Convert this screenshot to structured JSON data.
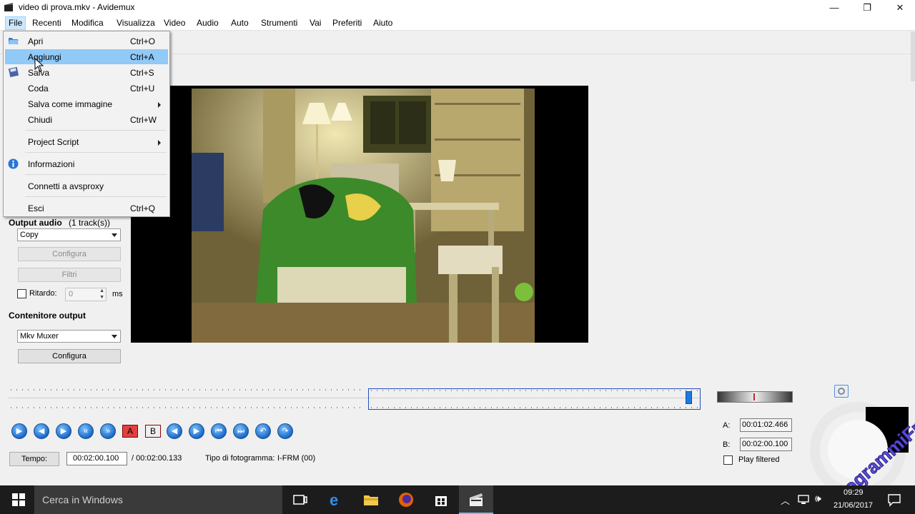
{
  "window": {
    "title": "video di prova.mkv - Avidemux",
    "minimize_glyph": "—",
    "maximize_glyph": "❐",
    "close_glyph": "✕"
  },
  "menubar": [
    "File",
    "Recenti",
    "Modifica",
    "Visualizza",
    "Video",
    "Audio",
    "Auto",
    "Strumenti",
    "Vai",
    "Preferiti",
    "Aiuto"
  ],
  "file_menu": {
    "items": [
      {
        "label": "Apri",
        "shortcut": "Ctrl+O",
        "icon": "open-folder-icon"
      },
      {
        "label": "Aggiungi",
        "shortcut": "Ctrl+A",
        "highlighted": true
      },
      {
        "label": "Salva",
        "shortcut": "Ctrl+S",
        "icon": "save-icon"
      },
      {
        "label": "Coda",
        "shortcut": "Ctrl+U"
      },
      {
        "label": "Salva come immagine",
        "submenu": true
      },
      {
        "label": "Chiudi",
        "shortcut": "Ctrl+W"
      },
      {
        "label": "Project Script",
        "submenu": true
      },
      {
        "label": "Informazioni",
        "icon": "info-icon"
      },
      {
        "label": "Connetti a avsproxy"
      },
      {
        "label": "Esci",
        "shortcut": "Ctrl+Q"
      }
    ]
  },
  "left_panel": {
    "output_audio_label": "Output audio",
    "output_audio_tracks": "(1 track(s))",
    "audio_codec": "Copy",
    "configure_label": "Configura",
    "filters_label": "Filtri",
    "delay_label": "Ritardo:",
    "delay_value": "0",
    "delay_unit": "ms",
    "container_label": "Contenitore output",
    "container_value": "Mkv Muxer",
    "container_configure_label": "Configura"
  },
  "controls": {
    "mark_a": "A",
    "mark_b": "B",
    "time_button": "Tempo:",
    "current_time": "00:02:00.100",
    "total_time": "/ 00:02:00.133",
    "frame_type_label": "Tipo di fotogramma:",
    "frame_type_value": "I-FRM (00)",
    "timeline_position": 0.985
  },
  "ab_panel": {
    "a_label": "A:",
    "a_value": "00:01:02.466",
    "b_label": "B:",
    "b_value": "00:02:00.100",
    "play_filtered_label": "Play filtered"
  },
  "taskbar": {
    "search_placeholder": "Cerca in Windows",
    "time": "09:29",
    "date": "21/06/2017"
  },
  "watermark": {
    "text": "ProgrammiFree.com"
  }
}
